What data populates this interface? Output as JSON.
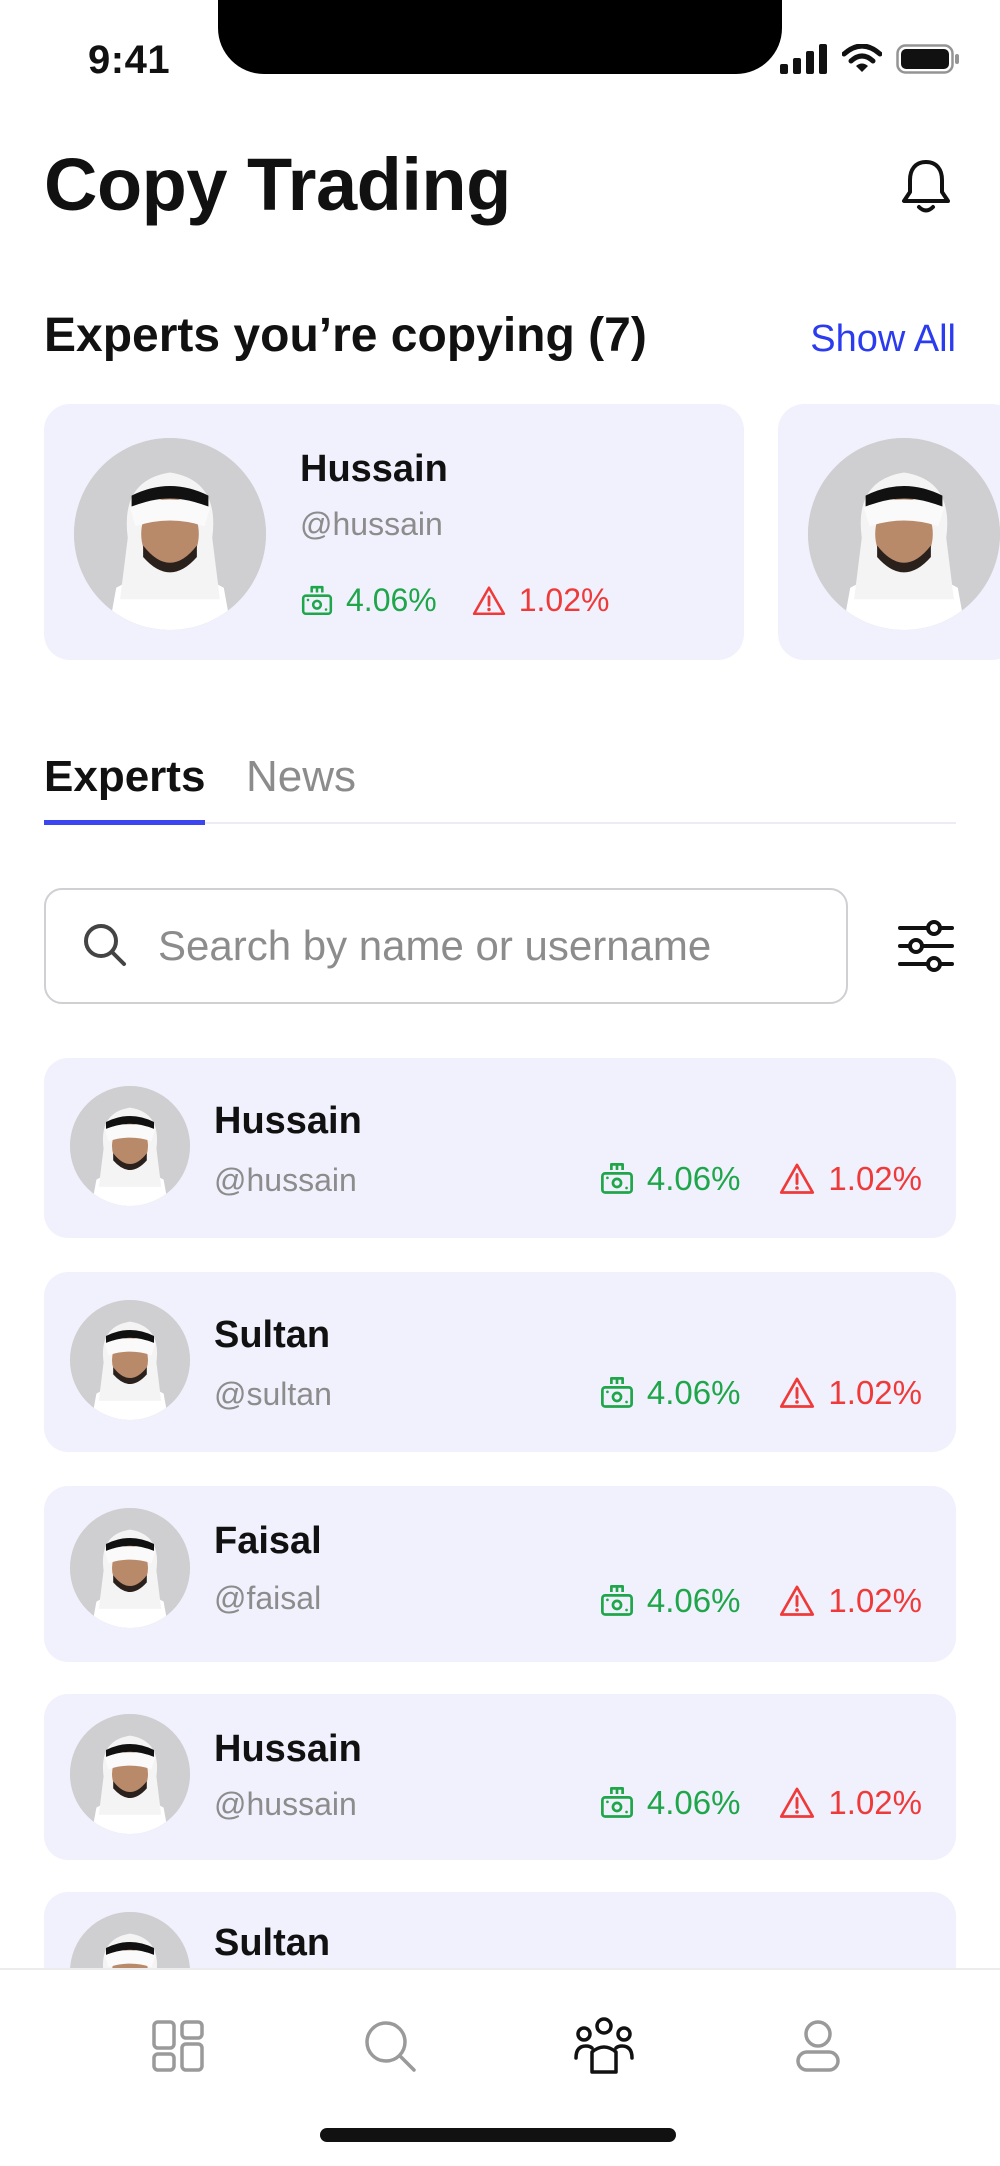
{
  "status_bar": {
    "time": "9:41"
  },
  "header": {
    "title": "Copy Trading"
  },
  "copying": {
    "title": "Experts you’re copying (7)",
    "show_all_label": "Show All",
    "cards": [
      {
        "name": "Hussain",
        "handle": "@hussain",
        "gain": "4.06%",
        "risk": "1.02%"
      }
    ]
  },
  "tabs": [
    {
      "label": "Experts",
      "active": true
    },
    {
      "label": "News",
      "active": false
    }
  ],
  "search": {
    "placeholder": "Search by name or username",
    "value": ""
  },
  "experts": [
    {
      "name": "Hussain",
      "handle": "@hussain",
      "gain": "4.06%",
      "risk": "1.02%"
    },
    {
      "name": "Sultan",
      "handle": "@sultan",
      "gain": "4.06%",
      "risk": "1.02%"
    },
    {
      "name": "Faisal",
      "handle": "@faisal",
      "gain": "4.06%",
      "risk": "1.02%"
    },
    {
      "name": "Hussain",
      "handle": "@hussain",
      "gain": "4.06%",
      "risk": "1.02%"
    },
    {
      "name": "Sultan"
    }
  ],
  "bottom_nav": [
    {
      "icon": "grid-icon",
      "active": false
    },
    {
      "icon": "search-icon",
      "active": false
    },
    {
      "icon": "people-icon",
      "active": true
    },
    {
      "icon": "profile-icon",
      "active": false
    }
  ],
  "colors": {
    "accent": "#3b46f0",
    "link": "#2b3bf0",
    "gain": "#1fa64a",
    "risk": "#ef3a3a",
    "card_bg": "#f1f1fd",
    "muted": "#8c8c8c"
  }
}
